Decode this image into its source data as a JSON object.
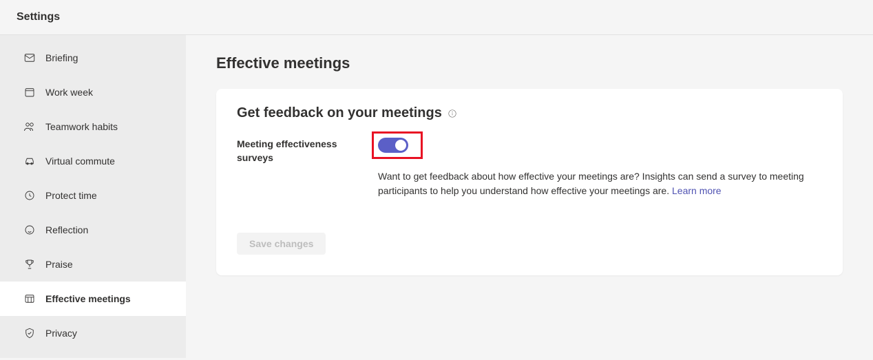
{
  "header": {
    "title": "Settings"
  },
  "sidebar": {
    "items": [
      {
        "label": "Briefing",
        "icon": "mail-icon",
        "active": false
      },
      {
        "label": "Work week",
        "icon": "calendar-icon",
        "active": false
      },
      {
        "label": "Teamwork habits",
        "icon": "people-icon",
        "active": false
      },
      {
        "label": "Virtual commute",
        "icon": "car-icon",
        "active": false
      },
      {
        "label": "Protect time",
        "icon": "clock-icon",
        "active": false
      },
      {
        "label": "Reflection",
        "icon": "smile-icon",
        "active": false
      },
      {
        "label": "Praise",
        "icon": "trophy-icon",
        "active": false
      },
      {
        "label": "Effective meetings",
        "icon": "grid-icon",
        "active": true
      },
      {
        "label": "Privacy",
        "icon": "shield-icon",
        "active": false
      }
    ]
  },
  "main": {
    "page_title": "Effective meetings",
    "card": {
      "title": "Get feedback on your meetings",
      "setting_label": "Meeting effectiveness surveys",
      "toggle_on": true,
      "description": "Want to get feedback about how effective your meetings are? Insights can send a survey to meeting participants to help you understand how effective your meetings are. ",
      "learn_more_label": "Learn more",
      "save_label": "Save changes"
    }
  }
}
